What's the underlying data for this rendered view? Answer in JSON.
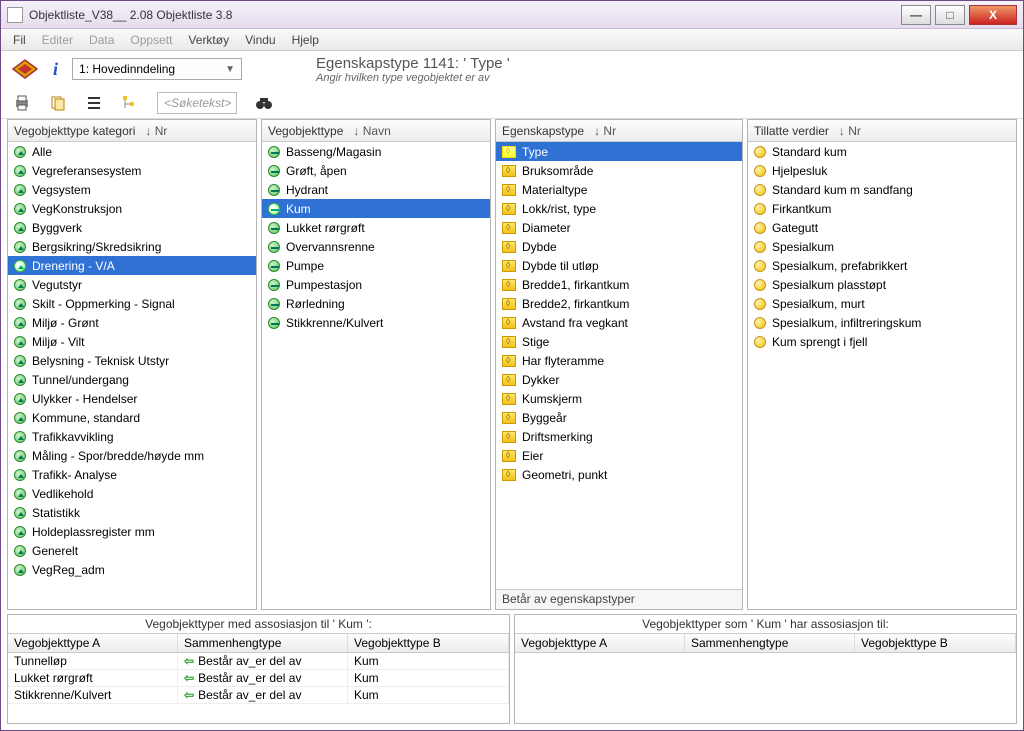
{
  "window": {
    "title": "Objektliste_V38__ 2.08 Objektliste 3.8"
  },
  "win_buttons": {
    "min": "—",
    "max": "□",
    "close": "X"
  },
  "menu": [
    "Fil",
    "Editer",
    "Data",
    "Oppsett",
    "Verktøy",
    "Vindu",
    "Hjelp"
  ],
  "menu_disabled_indices": [
    1,
    2,
    3
  ],
  "top": {
    "combo": "1: Hovedinndeling",
    "header1": "Egenskapstype 1141:   ' Type '",
    "header2": "Angir hvilken type vegobjektet er av"
  },
  "search": {
    "placeholder": "<Søketekst>"
  },
  "col1": {
    "title": "Vegobjekttype kategori",
    "sort": "↓ Nr",
    "items": [
      "Alle",
      "Vegreferansesystem",
      "Vegsystem",
      "VegKonstruksjon",
      "Byggverk",
      "Bergsikring/Skredsikring",
      "Drenering - V/A",
      "Vegutstyr",
      "Skilt - Oppmerking - Signal",
      "Miljø - Grønt",
      "Miljø - Vilt",
      "Belysning - Teknisk Utstyr",
      "Tunnel/undergang",
      "Ulykker - Hendelser",
      "Kommune, standard",
      "Trafikkavvikling",
      "Måling - Spor/bredde/høyde mm",
      "Trafikk-  Analyse",
      "Vedlikehold",
      "Statistikk",
      "Holdeplassregister mm",
      "Generelt",
      "VegReg_adm"
    ],
    "selected_index": 6
  },
  "col2": {
    "title": "Vegobjekttype",
    "sort": "↓ Navn",
    "items": [
      "Basseng/Magasin",
      "Grøft, åpen",
      "Hydrant",
      "Kum",
      "Lukket rørgrøft",
      "Overvannsrenne",
      "Pumpe",
      "Pumpestasjon",
      "Rørledning",
      "Stikkrenne/Kulvert"
    ],
    "selected_index": 3
  },
  "col3": {
    "title": "Egenskapstype",
    "sort": "↓ Nr",
    "items": [
      "Type",
      "Bruksområde",
      "Materialtype",
      "Lokk/rist, type",
      "Diameter",
      "Dybde",
      "Dybde til utløp",
      "Bredde1, firkantkum",
      "Bredde2, firkantkum",
      "Avstand fra vegkant",
      "Stige",
      "Har flyteramme",
      "Dykker",
      "Kumskjerm",
      "Byggeår",
      "Driftsmerking",
      "Eier",
      "Geometri, punkt"
    ],
    "selected_index": 0,
    "footer": "Betår av egenskapstyper"
  },
  "col4": {
    "title": "Tillatte verdier",
    "sort": "↓ Nr",
    "items": [
      "Standard kum",
      "Hjelpesluk",
      "Standard kum m sandfang",
      "Firkantkum",
      "Gategutt",
      "Spesialkum",
      "Spesialkum, prefabrikkert",
      "Spesialkum plasstøpt",
      "Spesialkum, murt",
      "Spesialkum, infiltreringskum",
      "Kum sprengt i fjell"
    ]
  },
  "assoc_left": {
    "title": "Vegobjekttyper med assosiasjon til ' Kum ':",
    "headers": [
      "Vegobjekttype A",
      "Sammenhengtype",
      "Vegobjekttype B"
    ],
    "rows": [
      [
        "Tunnelløp",
        "Består av_er del av",
        "Kum"
      ],
      [
        "Lukket rørgrøft",
        "Består av_er del av",
        "Kum"
      ],
      [
        "Stikkrenne/Kulvert",
        "Består av_er del av",
        "Kum"
      ]
    ]
  },
  "assoc_right": {
    "title": "Vegobjekttyper som ' Kum ' har assosiasjon til:",
    "headers": [
      "Vegobjekttype A",
      "Sammenhengtype",
      "Vegobjekttype B"
    ],
    "rows": []
  }
}
